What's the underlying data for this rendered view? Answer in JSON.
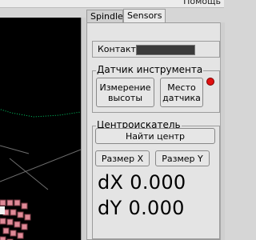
{
  "menubar": {
    "help": "Помощь"
  },
  "tabs": [
    {
      "label": "Spindle"
    },
    {
      "label": "Sensors"
    }
  ],
  "sensors": {
    "contact_label": "Контакт",
    "tool_sensor": {
      "title": "Датчик инструмента",
      "measure_button": "Измерение высоты",
      "place_button": "Место датчика",
      "indicator_color": "#e01010"
    },
    "centre_finder": {
      "title": "Центроискатель",
      "find_center_button": "Найти центр",
      "size_x_button": "Размер X",
      "size_y_button": "Размер Y",
      "dx_label": "dX",
      "dx_value": "0.000",
      "dy_label": "dY",
      "dy_value": "0.000"
    }
  },
  "colors": {
    "contact_indicator": "#3b3b3b",
    "canvas_bg": "#000000",
    "tool_path": "#00cc66"
  }
}
